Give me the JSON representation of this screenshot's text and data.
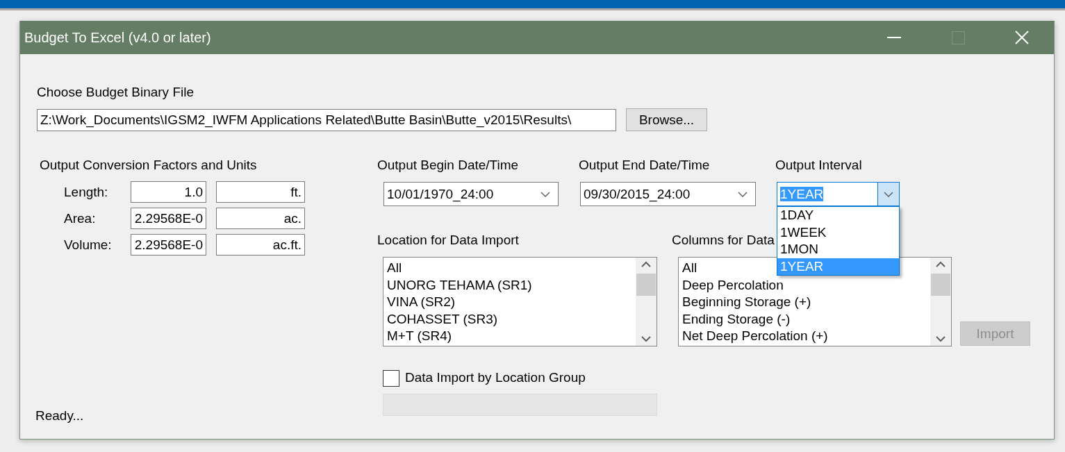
{
  "window": {
    "title": "Budget To Excel (v4.0 or later)",
    "maximize_disabled": true
  },
  "file": {
    "label": "Choose Budget Binary File",
    "value": "Z:\\Work_Documents\\IGSM2_IWFM Applications Related\\Butte Basin\\Butte_v2015\\Results\\",
    "browse": "Browse..."
  },
  "conversion": {
    "heading": "Output Conversion Factors and Units",
    "rows": [
      {
        "label": "Length:",
        "factor": "1.0",
        "unit": "ft."
      },
      {
        "label": "Area:",
        "factor": "2.29568E-0",
        "unit": "ac."
      },
      {
        "label": "Volume:",
        "factor": "2.29568E-0",
        "unit": "ac.ft."
      }
    ]
  },
  "begin": {
    "label": "Output Begin Date/Time",
    "value": "10/01/1970_24:00"
  },
  "end": {
    "label": "Output End Date/Time",
    "value": "09/30/2015_24:00"
  },
  "interval": {
    "label": "Output Interval",
    "value": "1YEAR",
    "expanded": true,
    "options": [
      {
        "label": "1DAY",
        "selected": false
      },
      {
        "label": "1WEEK",
        "selected": false
      },
      {
        "label": "1MON",
        "selected": false
      },
      {
        "label": "1YEAR",
        "selected": true
      }
    ]
  },
  "locations": {
    "label": "Location for Data Import",
    "items": [
      "All",
      "UNORG TEHAMA (SR1)",
      "VINA (SR2)",
      "COHASSET (SR3)",
      "M+T (SR4)"
    ]
  },
  "columns": {
    "label": "Columns for Data",
    "items": [
      "All",
      "Deep Percolation",
      "Beginning Storage (+)",
      "Ending Storage (-)",
      "Net Deep Percolation (+)"
    ]
  },
  "import": {
    "label": "Import",
    "disabled": true
  },
  "group_option": {
    "label": "Data Import by Location Group",
    "checked": false
  },
  "progress": {
    "level": 0
  },
  "status": "Ready..."
}
